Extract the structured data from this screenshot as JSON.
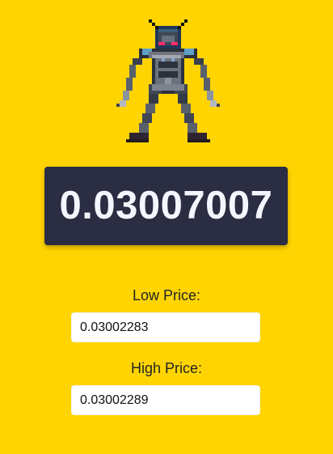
{
  "price": {
    "current_value": "0.03007007"
  },
  "low_price": {
    "label": "Low Price:",
    "value": "0.03002283"
  },
  "high_price": {
    "label": "High Price:",
    "value": "0.03002289"
  },
  "theme": {
    "background": "#FFD400",
    "price_box_background": "#2B2E43",
    "price_text_color": "#F4F6FF",
    "input_background": "#FFFFFF"
  },
  "sprite": {
    "icon_name": "pixel-robot-icon"
  }
}
